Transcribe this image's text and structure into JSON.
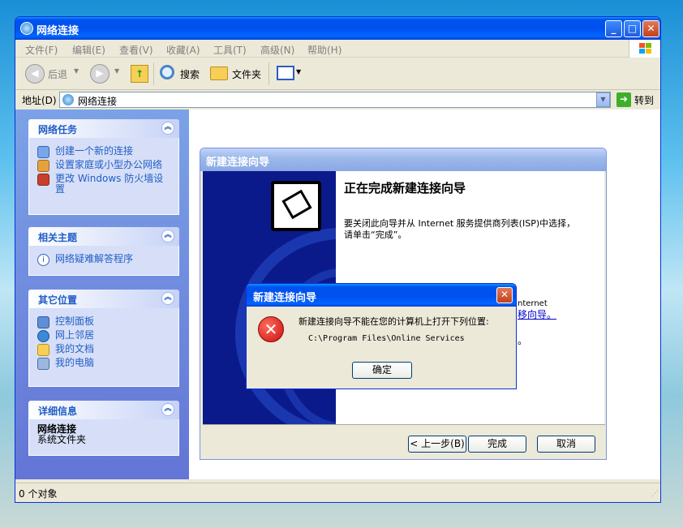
{
  "window": {
    "title": "网络连接"
  },
  "menu": [
    "文件(F)",
    "编辑(E)",
    "查看(V)",
    "收藏(A)",
    "工具(T)",
    "高级(N)",
    "帮助(H)"
  ],
  "toolbar": {
    "back": "后退",
    "search": "搜索",
    "folders": "文件夹"
  },
  "address": {
    "label": "地址(D)",
    "value": "网络连接",
    "go": "转到"
  },
  "panels": {
    "tasks": {
      "title": "网络任务",
      "items": [
        "创建一个新的连接",
        "设置家庭或小型办公网络",
        "更改 Windows 防火墙设置"
      ]
    },
    "related": {
      "title": "相关主题",
      "items": [
        "网络疑难解答程序"
      ]
    },
    "other": {
      "title": "其它位置",
      "items": [
        "控制面板",
        "网上邻居",
        "我的文档",
        "我的电脑"
      ]
    },
    "details": {
      "title": "详细信息",
      "name": "网络连接",
      "type": "系统文件夹"
    }
  },
  "status": {
    "text": "0 个对象"
  },
  "wizard": {
    "title": "新建连接向导",
    "heading": "正在完成新建连接向导",
    "text": "要关闭此向导并从 Internet 服务提供商列表(ISP)中选择，请单击“完成”。",
    "peek1": "nternet",
    "peek2": "移向导。",
    "peek3": "。",
    "back": "< 上一步(B)",
    "finish": "完成",
    "cancel": "取消"
  },
  "error": {
    "title": "新建连接向导",
    "message": "新建连接向导不能在您的计算机上打开下列位置:",
    "path": "C:\\Program Files\\Online Services",
    "ok": "确定"
  }
}
